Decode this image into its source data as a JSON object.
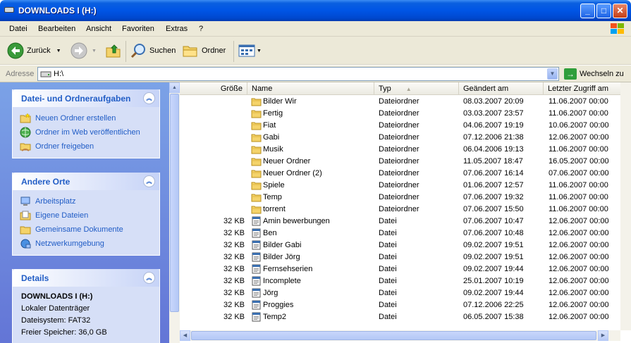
{
  "window": {
    "title": "DOWNLOADS I (H:)"
  },
  "menu": [
    "Datei",
    "Bearbeiten",
    "Ansicht",
    "Favoriten",
    "Extras",
    "?"
  ],
  "toolbar": {
    "back": "Zurück",
    "search": "Suchen",
    "folders": "Ordner"
  },
  "address": {
    "label": "Adresse",
    "value": "H:\\",
    "go": "Wechseln zu"
  },
  "tasks": {
    "title": "Datei- und Ordneraufgaben",
    "items": [
      "Neuen Ordner erstellen",
      "Ordner im Web veröffentlichen",
      "Ordner freigeben"
    ]
  },
  "places": {
    "title": "Andere Orte",
    "items": [
      "Arbeitsplatz",
      "Eigene Dateien",
      "Gemeinsame Dokumente",
      "Netzwerkumgebung"
    ]
  },
  "details": {
    "title": "Details",
    "name": "DOWNLOADS I (H:)",
    "kind": "Lokaler Datenträger",
    "fs": "Dateisystem: FAT32",
    "free": "Freier Speicher: 36,0 GB"
  },
  "columns": {
    "size": "Größe",
    "name": "Name",
    "type": "Typ",
    "modified": "Geändert am",
    "accessed": "Letzter Zugriff am"
  },
  "files": [
    {
      "size": "",
      "name": "Bilder Wir",
      "type": "Dateiordner",
      "modified": "08.03.2007 20:09",
      "accessed": "11.06.2007 00:00",
      "kind": "folder"
    },
    {
      "size": "",
      "name": "Fertig",
      "type": "Dateiordner",
      "modified": "03.03.2007 23:57",
      "accessed": "11.06.2007 00:00",
      "kind": "folder"
    },
    {
      "size": "",
      "name": "Fiat",
      "type": "Dateiordner",
      "modified": "04.06.2007 19:19",
      "accessed": "10.06.2007 00:00",
      "kind": "folder"
    },
    {
      "size": "",
      "name": "Gabi",
      "type": "Dateiordner",
      "modified": "07.12.2006 21:38",
      "accessed": "12.06.2007 00:00",
      "kind": "folder"
    },
    {
      "size": "",
      "name": "Musik",
      "type": "Dateiordner",
      "modified": "06.04.2006 19:13",
      "accessed": "11.06.2007 00:00",
      "kind": "folder"
    },
    {
      "size": "",
      "name": "Neuer Ordner",
      "type": "Dateiordner",
      "modified": "11.05.2007 18:47",
      "accessed": "16.05.2007 00:00",
      "kind": "folder"
    },
    {
      "size": "",
      "name": "Neuer Ordner (2)",
      "type": "Dateiordner",
      "modified": "07.06.2007 16:14",
      "accessed": "07.06.2007 00:00",
      "kind": "folder"
    },
    {
      "size": "",
      "name": "Spiele",
      "type": "Dateiordner",
      "modified": "01.06.2007 12:57",
      "accessed": "11.06.2007 00:00",
      "kind": "folder"
    },
    {
      "size": "",
      "name": "Temp",
      "type": "Dateiordner",
      "modified": "07.06.2007 19:32",
      "accessed": "11.06.2007 00:00",
      "kind": "folder"
    },
    {
      "size": "",
      "name": "torrent",
      "type": "Dateiordner",
      "modified": "07.06.2007 15:50",
      "accessed": "11.06.2007 00:00",
      "kind": "folder"
    },
    {
      "size": "32 KB",
      "name": "Amin bewerbungen",
      "type": "Datei",
      "modified": "07.06.2007 10:47",
      "accessed": "12.06.2007 00:00",
      "kind": "file"
    },
    {
      "size": "32 KB",
      "name": "Ben",
      "type": "Datei",
      "modified": "07.06.2007 10:48",
      "accessed": "12.06.2007 00:00",
      "kind": "file"
    },
    {
      "size": "32 KB",
      "name": "Bilder Gabi",
      "type": "Datei",
      "modified": "09.02.2007 19:51",
      "accessed": "12.06.2007 00:00",
      "kind": "file"
    },
    {
      "size": "32 KB",
      "name": "Bilder Jörg",
      "type": "Datei",
      "modified": "09.02.2007 19:51",
      "accessed": "12.06.2007 00:00",
      "kind": "file"
    },
    {
      "size": "32 KB",
      "name": "Fernsehserien",
      "type": "Datei",
      "modified": "09.02.2007 19:44",
      "accessed": "12.06.2007 00:00",
      "kind": "file"
    },
    {
      "size": "32 KB",
      "name": "Incomplete",
      "type": "Datei",
      "modified": "25.01.2007 10:19",
      "accessed": "12.06.2007 00:00",
      "kind": "file"
    },
    {
      "size": "32 KB",
      "name": "Jörg",
      "type": "Datei",
      "modified": "09.02.2007 19:44",
      "accessed": "12.06.2007 00:00",
      "kind": "file"
    },
    {
      "size": "32 KB",
      "name": "Proggies",
      "type": "Datei",
      "modified": "07.12.2006 22:25",
      "accessed": "12.06.2007 00:00",
      "kind": "file"
    },
    {
      "size": "32 KB",
      "name": "Temp2",
      "type": "Datei",
      "modified": "06.05.2007 15:38",
      "accessed": "12.06.2007 00:00",
      "kind": "file"
    }
  ]
}
